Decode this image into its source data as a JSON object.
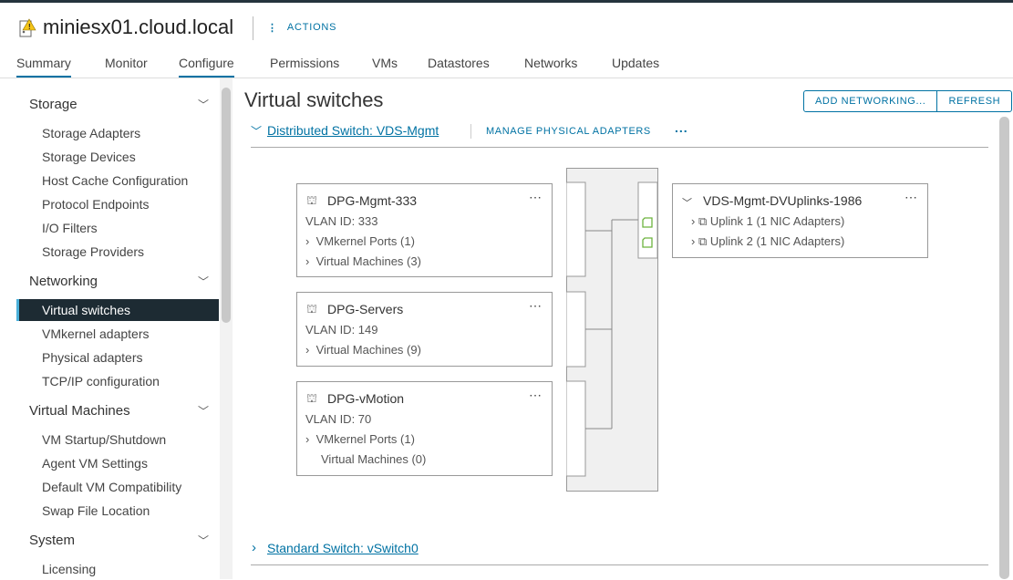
{
  "header": {
    "title": "miniesx01.cloud.local",
    "actions": "ACTIONS",
    "host_icon": "host-warning-icon"
  },
  "tabs": [
    "Summary",
    "Monitor",
    "Configure",
    "Permissions",
    "VMs",
    "Datastores",
    "Networks",
    "Updates"
  ],
  "sidebar": {
    "sections": [
      {
        "label": "Storage",
        "items": [
          "Storage Adapters",
          "Storage Devices",
          "Host Cache Configuration",
          "Protocol Endpoints",
          "I/O Filters",
          "Storage Providers"
        ]
      },
      {
        "label": "Networking",
        "items": [
          "Virtual switches",
          "VMkernel adapters",
          "Physical adapters",
          "TCP/IP configuration"
        ]
      },
      {
        "label": "Virtual Machines",
        "items": [
          "VM Startup/Shutdown",
          "Agent VM Settings",
          "Default VM Compatibility",
          "Swap File Location"
        ]
      },
      {
        "label": "System",
        "items": [
          "Licensing"
        ]
      }
    ],
    "selected": "Virtual switches"
  },
  "main": {
    "title": "Virtual switches",
    "add_networking": "ADD NETWORKING...",
    "refresh": "REFRESH",
    "vds": {
      "label": "Distributed Switch: VDS-Mgmt",
      "manage": "MANAGE PHYSICAL ADAPTERS",
      "more": "..."
    },
    "portgroups": [
      {
        "name": "DPG-Mgmt-333",
        "vlan": "VLAN ID: 333",
        "rows": [
          "VMkernel Ports (1)",
          "Virtual Machines (3)"
        ]
      },
      {
        "name": "DPG-Servers",
        "vlan": "VLAN ID: 149",
        "rows": [
          "Virtual Machines (9)"
        ]
      },
      {
        "name": "DPG-vMotion",
        "vlan": "VLAN ID: 70",
        "rows": [
          "VMkernel Ports (1)",
          "Virtual Machines (0)"
        ]
      }
    ],
    "uplinks": {
      "name": "VDS-Mgmt-DVUplinks-1986",
      "rows": [
        "Uplink 1 (1 NIC Adapters)",
        "Uplink 2 (1 NIC Adapters)"
      ]
    },
    "vss": {
      "label": "Standard Switch: vSwitch0"
    }
  },
  "colors": {
    "accent": "#0072a3",
    "selected_bg": "#1d2b33",
    "nic": "#6db33f"
  }
}
